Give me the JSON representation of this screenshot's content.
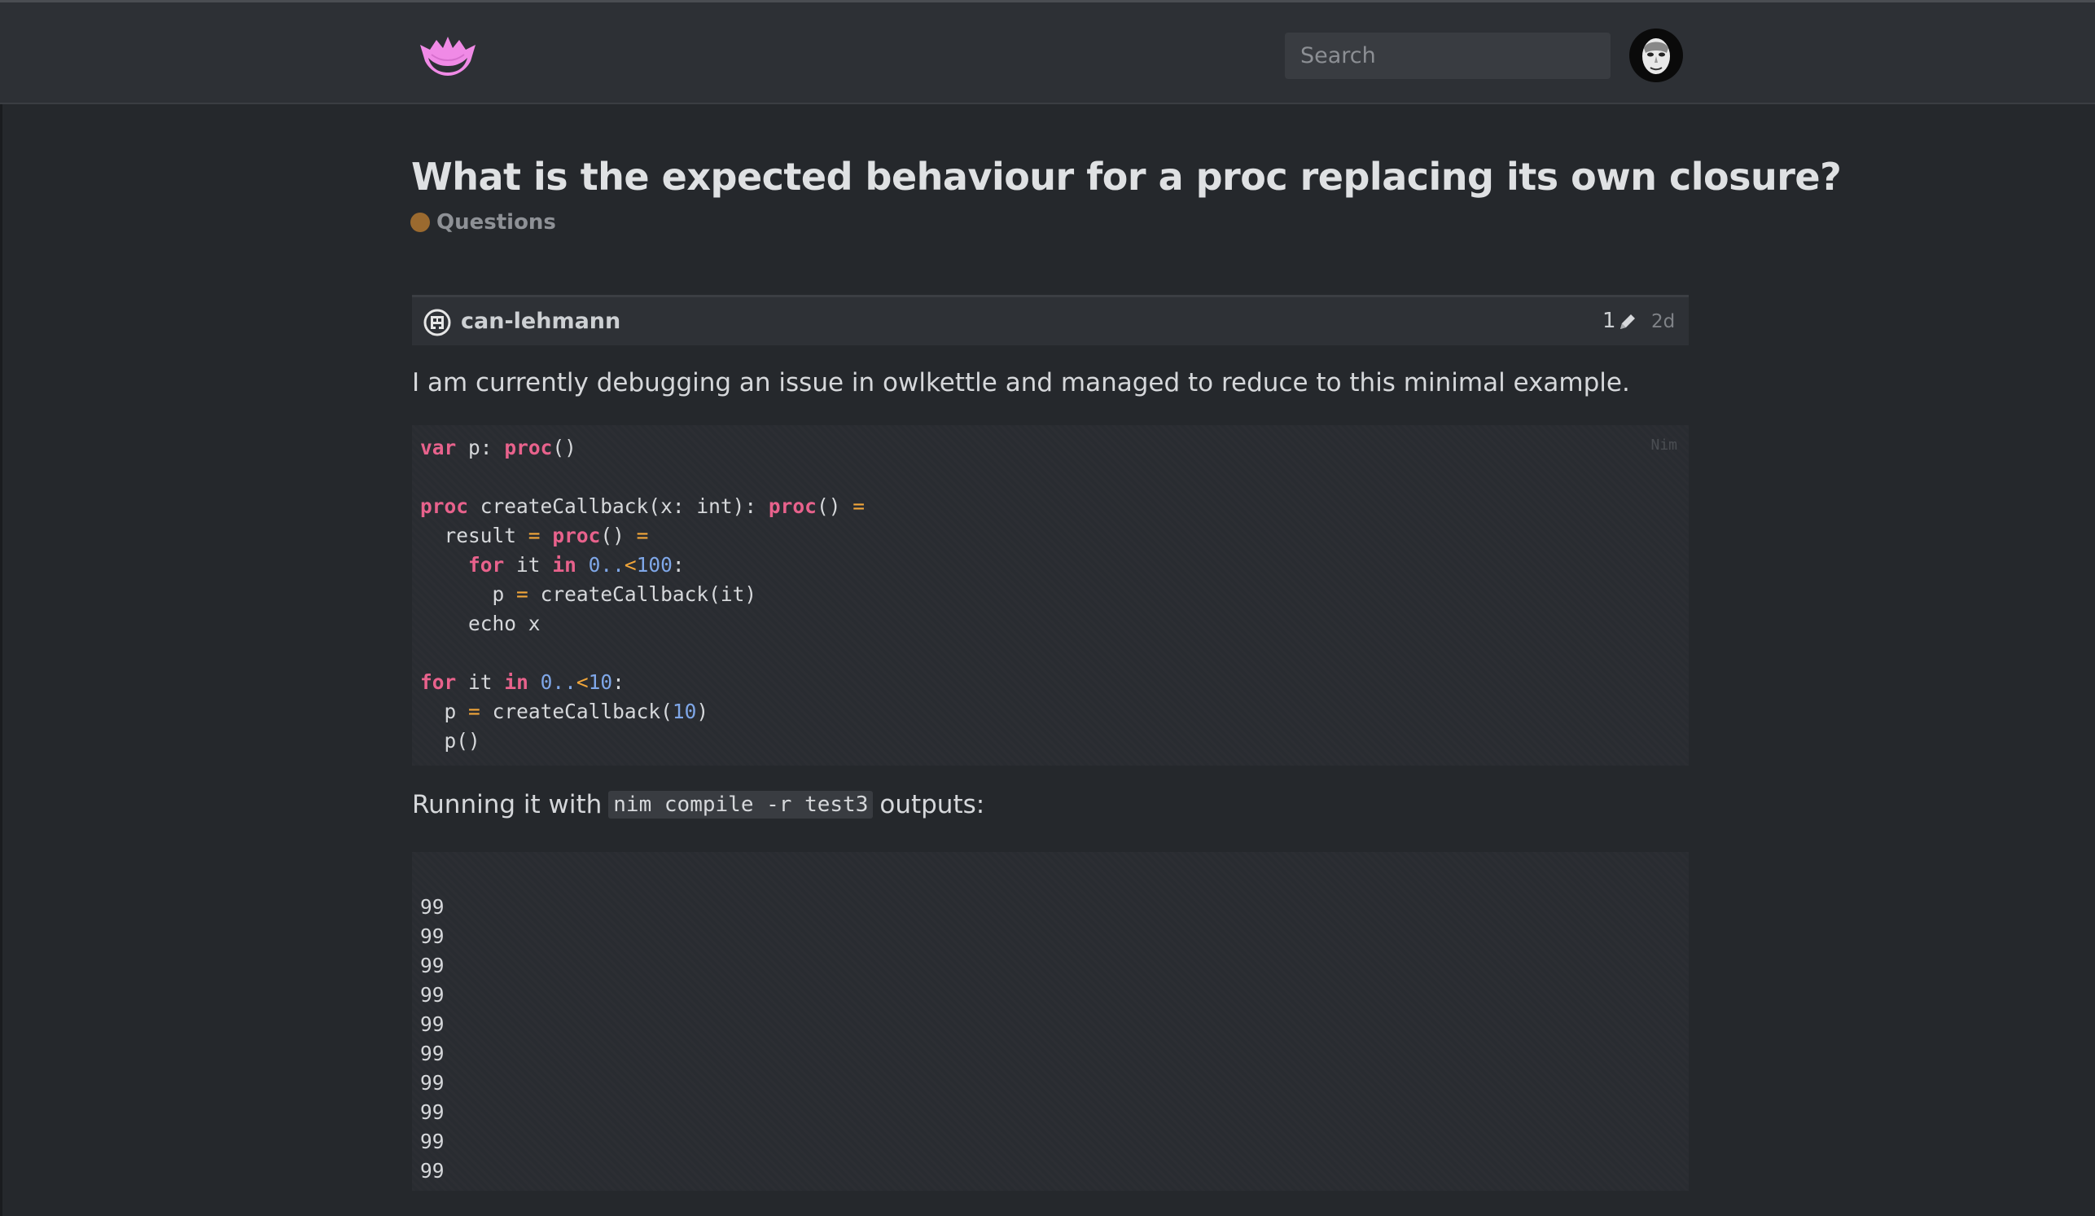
{
  "header": {
    "search_placeholder": "Search"
  },
  "topic": {
    "title": "What is the expected behaviour for a proc replacing its own closure?",
    "category": "Questions",
    "category_color": "#9b6a2f"
  },
  "post": {
    "author": "can-lehmann",
    "edit_count": "1",
    "time": "2d",
    "intro": "I am currently debugging an issue in owlkettle and managed to reduce to this minimal example.",
    "code_language": "Nim",
    "code_lines": [
      "var p: proc()",
      "",
      "proc createCallback(x: int): proc() =",
      "  result = proc() =",
      "    for it in 0..<100:",
      "      p = createCallback(it)",
      "    echo x",
      "",
      "for it in 0..<10:",
      "  p = createCallback(10)",
      "  p()"
    ],
    "running_before": "Running it with",
    "running_code": "nim compile -r test3",
    "running_after": "outputs:",
    "output_lines": [
      "99",
      "99",
      "99",
      "99",
      "99",
      "99",
      "99",
      "99",
      "99",
      "99"
    ]
  },
  "colors": {
    "keyword": "#e8628c",
    "operator": "#f2a63a",
    "number": "#7fa7e8",
    "logo": "#f08ae6"
  }
}
